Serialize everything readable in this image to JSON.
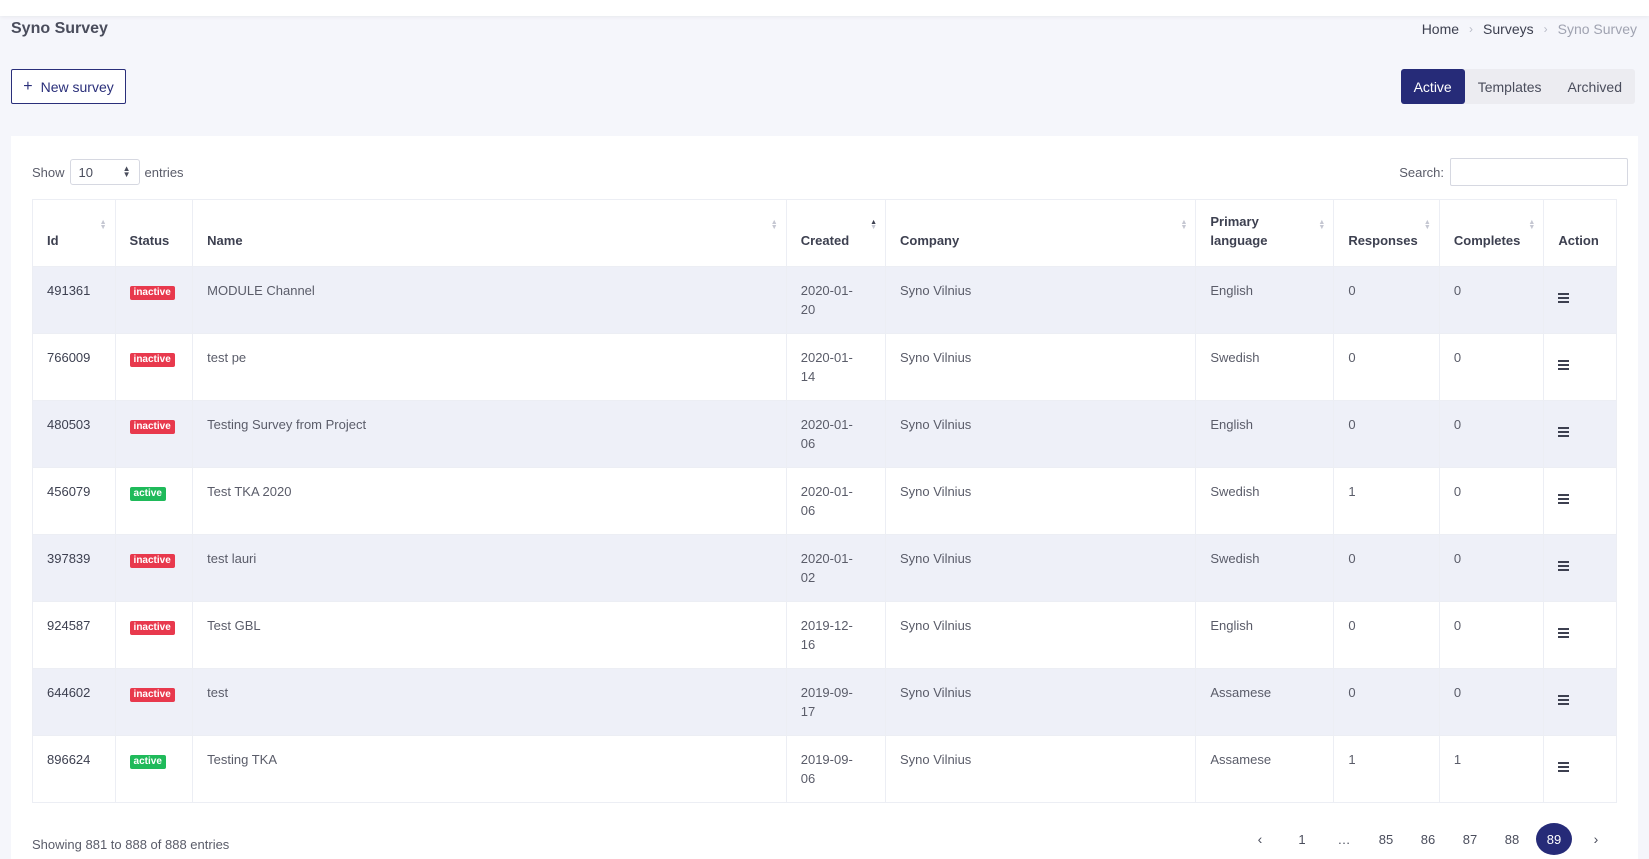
{
  "header": {
    "title": "Syno Survey",
    "breadcrumb": [
      "Home",
      "Surveys",
      "Syno Survey"
    ]
  },
  "toolbar": {
    "new_survey_label": "New survey",
    "tabs": [
      {
        "label": "Active",
        "active": true
      },
      {
        "label": "Templates",
        "active": false
      },
      {
        "label": "Archived",
        "active": false
      }
    ]
  },
  "table_controls": {
    "show_label": "Show",
    "page_size": "10",
    "entries_label": "entries",
    "search_label": "Search:",
    "search_value": ""
  },
  "table": {
    "columns": [
      "Id",
      "Status",
      "Name",
      "Created",
      "Company",
      "Primary language",
      "Responses",
      "Completes",
      "Action"
    ],
    "rows": [
      {
        "id": "491361",
        "status": "inactive",
        "name": "MODULE Channel",
        "created": "2020-01-20",
        "company": "Syno Vilnius",
        "language": "English",
        "responses": "0",
        "completes": "0"
      },
      {
        "id": "766009",
        "status": "inactive",
        "name": "test pe",
        "created": "2020-01-14",
        "company": "Syno Vilnius",
        "language": "Swedish",
        "responses": "0",
        "completes": "0"
      },
      {
        "id": "480503",
        "status": "inactive",
        "name": "Testing Survey from Project",
        "created": "2020-01-06",
        "company": "Syno Vilnius",
        "language": "English",
        "responses": "0",
        "completes": "0"
      },
      {
        "id": "456079",
        "status": "active",
        "name": "Test TKA 2020",
        "created": "2020-01-06",
        "company": "Syno Vilnius",
        "language": "Swedish",
        "responses": "1",
        "completes": "0"
      },
      {
        "id": "397839",
        "status": "inactive",
        "name": "test lauri",
        "created": "2020-01-02",
        "company": "Syno Vilnius",
        "language": "Swedish",
        "responses": "0",
        "completes": "0"
      },
      {
        "id": "924587",
        "status": "inactive",
        "name": "Test GBL",
        "created": "2019-12-16",
        "company": "Syno Vilnius",
        "language": "English",
        "responses": "0",
        "completes": "0"
      },
      {
        "id": "644602",
        "status": "inactive",
        "name": "test",
        "created": "2019-09-17",
        "company": "Syno Vilnius",
        "language": "Assamese",
        "responses": "0",
        "completes": "0"
      },
      {
        "id": "896624",
        "status": "active",
        "name": "Testing TKA",
        "created": "2019-09-06",
        "company": "Syno Vilnius",
        "language": "Assamese",
        "responses": "1",
        "completes": "1"
      }
    ]
  },
  "footer": {
    "info": "Showing 881 to 888 of 888 entries",
    "pages": [
      "1",
      "…",
      "85",
      "86",
      "87",
      "88",
      "89"
    ],
    "current_page": "89"
  },
  "colors": {
    "accent": "#262b78",
    "inactive_badge": "#e8394d",
    "active_badge": "#1fba5a",
    "stripe": "#eef0f8"
  }
}
